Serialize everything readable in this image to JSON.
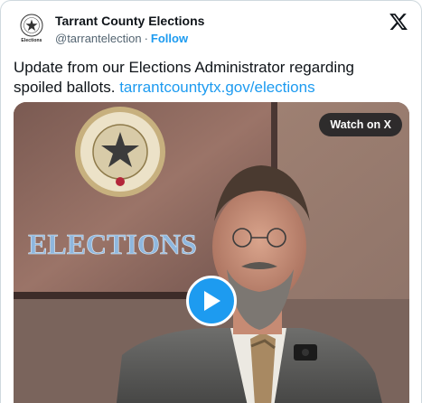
{
  "account": {
    "display_name": "Tarrant County Elections",
    "handle": "@tarrantelection",
    "separator": "·",
    "follow_label": "Follow",
    "avatar_text": "Elections"
  },
  "tweet": {
    "text": "Update from our Elections Administrator regarding spoiled ballots. ",
    "link_text": "tarrantcountytx.gov/elections"
  },
  "media": {
    "watch_label": "Watch on X",
    "sign_text": "ELECTIONS",
    "seal_text": "TARRANT COUNTY TEXAS"
  },
  "icons": {
    "logo": "x-logo-icon",
    "play": "play-icon",
    "avatar": "county-seal-icon"
  },
  "colors": {
    "accent": "#1d9bf0",
    "text": "#0f1419",
    "muted": "#536471"
  }
}
